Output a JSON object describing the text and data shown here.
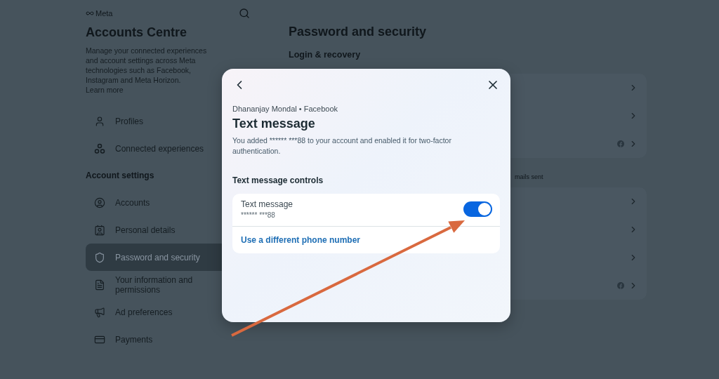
{
  "sidebar": {
    "logo": "Meta",
    "title": "Accounts Centre",
    "description": "Manage your connected experiences and account settings across Meta technologies such as Facebook, Instagram and Meta Horizon.",
    "learn_more": "Learn more",
    "items": [
      {
        "kind": "item",
        "label": "Profiles",
        "selected": false
      },
      {
        "kind": "item",
        "label": "Connected experiences",
        "selected": false
      },
      {
        "kind": "heading",
        "label": "Account settings"
      },
      {
        "kind": "item",
        "label": "Accounts",
        "selected": false
      },
      {
        "kind": "item",
        "label": "Personal details",
        "selected": false
      },
      {
        "kind": "item",
        "label": "Password and security",
        "selected": true
      },
      {
        "kind": "item",
        "label": "Your information and permissions",
        "selected": false
      },
      {
        "kind": "item",
        "label": "Ad preferences",
        "selected": false
      },
      {
        "kind": "item",
        "label": "Payments",
        "selected": false
      }
    ]
  },
  "main": {
    "title": "Password and security",
    "section": "Login & recovery",
    "note": "mails sent",
    "cards": [
      {
        "rows": [
          {
            "facebook": false
          },
          {
            "facebook": false
          },
          {
            "facebook": true
          }
        ]
      },
      {
        "rows": [
          {
            "facebook": false
          },
          {
            "facebook": false
          },
          {
            "facebook": false
          },
          {
            "facebook": true
          }
        ]
      }
    ]
  },
  "modal": {
    "account": "Dhananjay Mondal • Facebook",
    "title": "Text message",
    "description": "You added ****** ***88 to your account and enabled it for two-factor authentication.",
    "section": "Text message controls",
    "control": {
      "label": "Text message",
      "number": "****** ***88",
      "on": true
    },
    "link": "Use a different phone number"
  }
}
